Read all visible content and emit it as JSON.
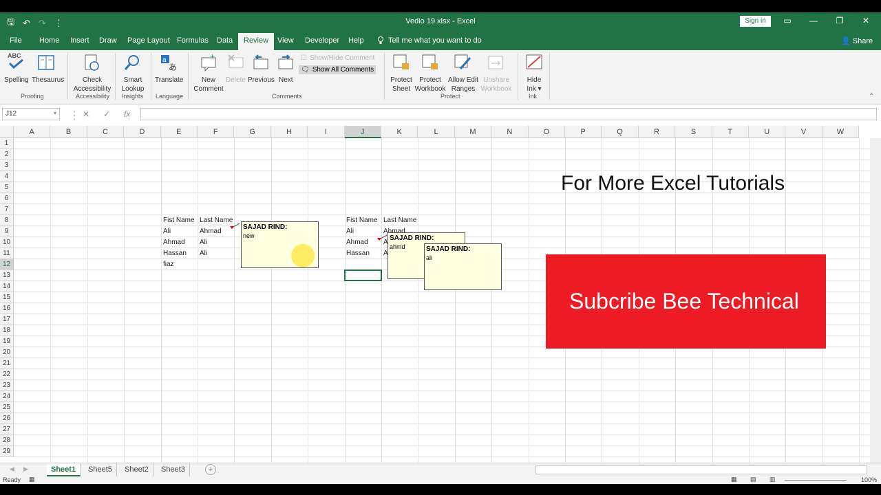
{
  "titlebar": {
    "title": "Vedio 19.xlsx  -  Excel",
    "signin": "Sign in",
    "qat_save": "🖫",
    "qat_undo": "↶",
    "qat_redo": "↷",
    "qat_more": "⋮",
    "restore_icon": "▭",
    "min_icon": "—",
    "max_icon": "❐",
    "close_icon": "✕"
  },
  "tabs": [
    "File",
    "Home",
    "Insert",
    "Draw",
    "Page Layout",
    "Formulas",
    "Data",
    "Review",
    "View",
    "Developer",
    "Help"
  ],
  "active_tab": "Review",
  "tell_me": "Tell me what you want to do",
  "share": "Share",
  "ribbon": {
    "spelling": "Spelling",
    "thesaurus": "Thesaurus",
    "proofing": "Proofing",
    "check": "Check",
    "accessibility_btn": "Accessibility",
    "accessibility": "Accessibility",
    "smart": "Smart",
    "lookup": "Lookup",
    "insights": "Insights",
    "translate": "Translate",
    "language": "Language",
    "new": "New",
    "comment": "Comment",
    "delete": "Delete",
    "previous": "Previous",
    "next": "Next",
    "show_hide": "Show/Hide Comment",
    "show_all": "Show All Comments",
    "comments": "Comments",
    "protect": "Protect",
    "sheet": "Sheet",
    "workbook": "Workbook",
    "allow_edit": "Allow Edit",
    "ranges": "Ranges",
    "unshare": "Unshare",
    "protect_group": "Protect",
    "hide": "Hide",
    "ink": "Ink",
    "ink_group": "Ink",
    "abc": "ABC"
  },
  "formula": {
    "namebox": "J12",
    "cancel": "✕",
    "enter": "✓",
    "fx": "fx"
  },
  "columns": [
    "A",
    "B",
    "C",
    "D",
    "E",
    "F",
    "G",
    "H",
    "I",
    "J",
    "K",
    "L",
    "M",
    "N",
    "O",
    "P",
    "Q",
    "R",
    "S",
    "T",
    "U",
    "V",
    "W"
  ],
  "rows": [
    "1",
    "2",
    "3",
    "4",
    "5",
    "6",
    "7",
    "8",
    "9",
    "10",
    "11",
    "12",
    "13",
    "14",
    "15",
    "16",
    "17",
    "18",
    "19",
    "20",
    "21",
    "22",
    "23",
    "24",
    "25",
    "26",
    "27",
    "28",
    "29"
  ],
  "table1": {
    "h1": "Fist Name",
    "h2": "Last Name",
    "r1a": "Ali",
    "r1b": "Ahmad",
    "r2a": "Ahmad",
    "r2b": "Ali",
    "r3a": "Hassan",
    "r3b": "Ali",
    "r4a": "fiaz"
  },
  "table2": {
    "h1": "Fist Name",
    "h2": "Last Name",
    "r1a": "Ali",
    "r1b": "Ahmad",
    "r2a": "Ahmad",
    "r2b": "A",
    "r3a": "Hassan",
    "r3b": "A"
  },
  "comment1": {
    "author": "SAJAD RIND:",
    "text": "new"
  },
  "comment2": {
    "author": "SAJAD RIND:",
    "text": "ahmd"
  },
  "comment3": {
    "author": "SAJAD RIND:",
    "text": "ali"
  },
  "promo": "For More Excel Tutorials",
  "subscribe": "Subcribe Bee Technical",
  "sheets": [
    "Sheet1",
    "Sheet5",
    "Sheet2",
    "Sheet3"
  ],
  "status": {
    "ready": "Ready",
    "zoom": "100%"
  },
  "colors": {
    "excel_green": "#217346",
    "banner_red": "#ed1c24",
    "comment_bg": "#ffffe1"
  }
}
